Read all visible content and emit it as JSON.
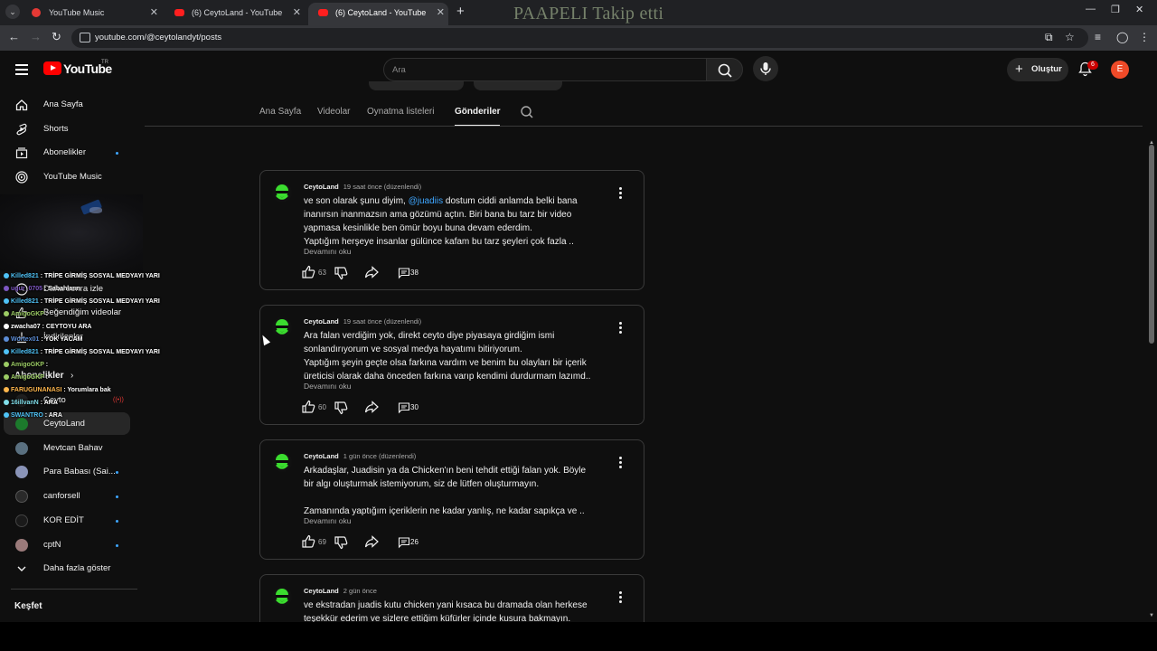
{
  "browser": {
    "tabs": [
      {
        "title": "YouTube Music",
        "icon": "youtube-music-icon",
        "active": false
      },
      {
        "title": "(6) CeytoLand - YouTube",
        "icon": "youtube-icon",
        "active": false
      },
      {
        "title": "(6) CeytoLand - YouTube",
        "icon": "youtube-icon",
        "active": true
      }
    ],
    "url": "youtube.com/@ceytolandyt/posts",
    "watermark": "PAAPELI Takip etti"
  },
  "header": {
    "logo_text": "YouTube",
    "region": "TR",
    "search_placeholder": "Ara",
    "create_label": "Oluştur",
    "notification_count": "6",
    "avatar_letter": "E"
  },
  "sidebar": {
    "main": [
      {
        "label": "Ana Sayfa",
        "icon": "home-icon"
      },
      {
        "label": "Shorts",
        "icon": "shorts-icon"
      },
      {
        "label": "Abonelikler",
        "icon": "subscriptions-icon"
      },
      {
        "label": "YouTube Music",
        "icon": "youtube-music-icon"
      }
    ],
    "you_items": [
      {
        "label": "Daha sonra izle"
      },
      {
        "label": "Beğendiğim videolar"
      },
      {
        "label": "İndirilenler"
      }
    ],
    "subs_heading": "Abonelikler",
    "subscriptions": [
      {
        "label": "Ceyto",
        "dot": false
      },
      {
        "label": "CeytoLand",
        "dot": false
      },
      {
        "label": "Mevtcan Bahav",
        "dot": false
      },
      {
        "label": "Para Babası (Sai...",
        "dot": true
      },
      {
        "label": "canforsell",
        "dot": true
      },
      {
        "label": "KOR EDİT",
        "dot": true
      },
      {
        "label": "cptN",
        "dot": true
      }
    ],
    "show_more": "Daha fazla göster",
    "explore_heading": "Keşfet"
  },
  "chat_overlay": [
    {
      "user": "Killed821",
      "text": "TRİPE GİRMİŞ SOSYAL MEDYAYI YARI",
      "color": "#4fc3f7"
    },
    {
      "user": "ugur_0705",
      "text": "Sabahların",
      "color": "#7e57c2"
    },
    {
      "user": "Killed821",
      "text": "TRİPE GİRMİŞ SOSYAL MEDYAYI YARI",
      "color": "#4fc3f7"
    },
    {
      "user": "AmigoGKP",
      "text": "",
      "color": "#9ccc65"
    },
    {
      "user": "zwacha07",
      "text": "CEYTOYU ARA",
      "color": "#ffffff"
    },
    {
      "user": "Wortex01",
      "text": "YOK YACAM",
      "color": "#5c8dd6"
    },
    {
      "user": "Killed821",
      "text": "TRİPE GİRMİŞ SOSYAL MEDYAYI YARI",
      "color": "#4fc3f7"
    },
    {
      "user": "AmigoGKP",
      "text": "",
      "color": "#9ccc65"
    },
    {
      "user": "AmigoGKP",
      "text": "",
      "color": "#9ccc65"
    },
    {
      "user": "FARUGUNANASI",
      "text": "Yorumlara bak",
      "color": "#ffb74d"
    },
    {
      "user": "16illvanN",
      "text": "ARA",
      "color": "#80deea"
    },
    {
      "user": "SWANTRO",
      "text": "ARA",
      "color": "#4fc3f7"
    }
  ],
  "channel": {
    "tabs": [
      "Ana Sayfa",
      "Videolar",
      "Oynatma listeleri",
      "Gönderiler"
    ],
    "active_tab": "Gönderiler"
  },
  "posts": [
    {
      "author": "CeytoLand",
      "time": "19 saat önce (düzenlendi)",
      "lines": [
        [
          "ve son olarak şunu diyim, ",
          "@juadiis",
          " dostum ciddi anlamda belki bana"
        ],
        [
          "inanırsın inanmazsın ama gözümü açtın. Biri bana bu tarz bir video"
        ],
        [
          "yapmasa kesinlikle ben ömür boyu buna devam ederdim."
        ],
        [
          "Yaptığım herşeye insanlar gülünce kafam bu tarz şeyleri çok fazla .."
        ]
      ],
      "read_more": "Devamını oku",
      "likes": "63",
      "comments": "38"
    },
    {
      "author": "CeytoLand",
      "time": "19 saat önce (düzenlendi)",
      "lines": [
        [
          "Ara falan verdiğim yok, direkt ceyto diye piyasaya girdiğim ismi"
        ],
        [
          "sonlandırıyorum ve sosyal medya hayatımı bitiriyorum."
        ],
        [
          "Yaptığım şeyin geçte olsa farkına vardım ve benim bu olayları bir içerik"
        ],
        [
          "üreticisi olarak daha önceden farkına varıp kendimi durdurmam lazımd.."
        ]
      ],
      "read_more": "Devamını oku",
      "likes": "60",
      "comments": "30"
    },
    {
      "author": "CeytoLand",
      "time": "1 gün önce (düzenlendi)",
      "lines": [
        [
          "Arkadaşlar, Juadisin ya da Chicken'ın beni tehdit ettiği falan yok. Böyle"
        ],
        [
          "bir algı oluşturmak istemiyorum, siz de lütfen oluşturmayın."
        ],
        [
          ""
        ],
        [
          "Zamanında yaptığım içeriklerin ne kadar yanlış, ne kadar sapıkça ve .."
        ]
      ],
      "read_more": "Devamını oku",
      "likes": "69",
      "comments": "26"
    },
    {
      "author": "CeytoLand",
      "time": "2 gün önce",
      "lines": [
        [
          "ve ekstradan juadis kutu chicken yani kısaca bu dramada olan herkese"
        ],
        [
          "teşekkür ederim ve sizlere ettiğim küfürler içinde kusura bakmayın."
        ]
      ],
      "read_more": "",
      "likes": "",
      "comments": ""
    }
  ]
}
